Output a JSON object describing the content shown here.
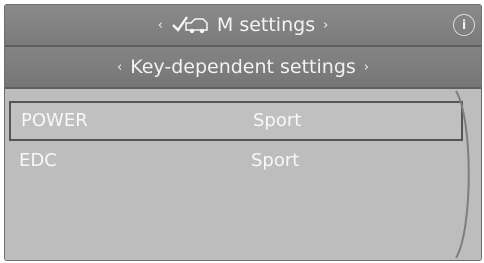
{
  "header": {
    "title": "M settings",
    "left_arrow": "‹",
    "right_arrow": "›",
    "icon": "car-check-icon",
    "info_icon": "info-icon"
  },
  "subheader": {
    "title": "Key-dependent settings",
    "left_arrow": "‹",
    "right_arrow": "›"
  },
  "rows": [
    {
      "key": "POWER",
      "value": "Sport",
      "selected": true
    },
    {
      "key": "EDC",
      "value": "Sport",
      "selected": false
    }
  ]
}
